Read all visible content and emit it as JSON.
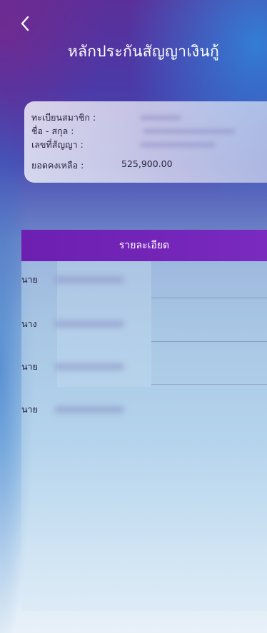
{
  "header": {
    "title": "หลักประกันสัญญาเงินกู้"
  },
  "info": {
    "member_reg_label": "ทะเบียนสมาชิก :",
    "name_label": "ชื่อ - สกุล :",
    "contract_label": "เลขที่สัญญา :",
    "balance_label": "ยอดคงเหลือ :",
    "balance_value": "525,900.00"
  },
  "details": {
    "header_label": "รายละเอียด",
    "rows": [
      {
        "prefix": "นาย"
      },
      {
        "prefix": "นาง"
      },
      {
        "prefix": "นาย"
      },
      {
        "prefix": "นาย"
      }
    ]
  }
}
